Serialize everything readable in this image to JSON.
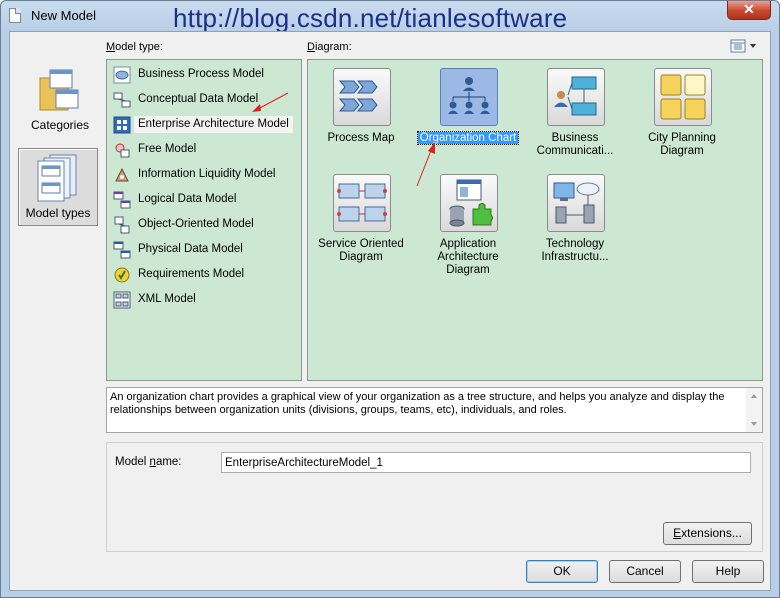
{
  "window": {
    "title": "New Model",
    "watermark": "http://blog.csdn.net/tianlesoftware",
    "close_label": "✕"
  },
  "nav": {
    "categories_label": "Categories",
    "model_types_label": "Model types"
  },
  "model_type": {
    "label_accel": "M",
    "label_rest": "odel type:",
    "items": [
      {
        "label": "Business Process Model",
        "icon": "business-process-icon"
      },
      {
        "label": "Conceptual Data Model",
        "icon": "conceptual-data-icon"
      },
      {
        "label": "Enterprise Architecture Model",
        "icon": "enterprise-architecture-icon"
      },
      {
        "label": "Free Model",
        "icon": "free-model-icon"
      },
      {
        "label": "Information Liquidity Model",
        "icon": "information-liquidity-icon"
      },
      {
        "label": "Logical Data Model",
        "icon": "logical-data-icon"
      },
      {
        "label": "Object-Oriented Model",
        "icon": "object-oriented-icon"
      },
      {
        "label": "Physical Data Model",
        "icon": "physical-data-icon"
      },
      {
        "label": "Requirements Model",
        "icon": "requirements-icon"
      },
      {
        "label": "XML Model",
        "icon": "xml-model-icon"
      }
    ],
    "selected": "Enterprise Architecture Model"
  },
  "diagram": {
    "label_accel": "D",
    "label_rest": "iagram:",
    "items": [
      {
        "label": "Process Map",
        "icon": "process-map-icon"
      },
      {
        "label": "Organization Chart",
        "icon": "organization-chart-icon"
      },
      {
        "label": "Business Communicati...",
        "icon": "business-communication-icon"
      },
      {
        "label": "City Planning Diagram",
        "icon": "city-planning-icon"
      },
      {
        "label": "Service Oriented Diagram",
        "icon": "service-oriented-icon"
      },
      {
        "label": "Application Architecture Diagram",
        "icon": "application-architecture-icon"
      },
      {
        "label": "Technology Infrastructu...",
        "icon": "technology-infrastructure-icon"
      }
    ],
    "selected": "Organization Chart"
  },
  "description": "An organization chart provides a graphical view of your organization as a tree structure, and helps you analyze and display the relationships between organization units (divisions, groups, teams, etc), individuals, and roles.",
  "model_name": {
    "label_pre": "Model ",
    "label_accel": "n",
    "label_post": "ame:",
    "value": "EnterpriseArchitectureModel_1"
  },
  "buttons": {
    "extensions_accel": "E",
    "extensions_rest": "xtensions...",
    "ok": "OK",
    "cancel": "Cancel",
    "help": "Help"
  },
  "colors": {
    "panel_bg": "#cde8d2",
    "selection": "#3399ff",
    "annotation_arrow": "#e02020"
  }
}
